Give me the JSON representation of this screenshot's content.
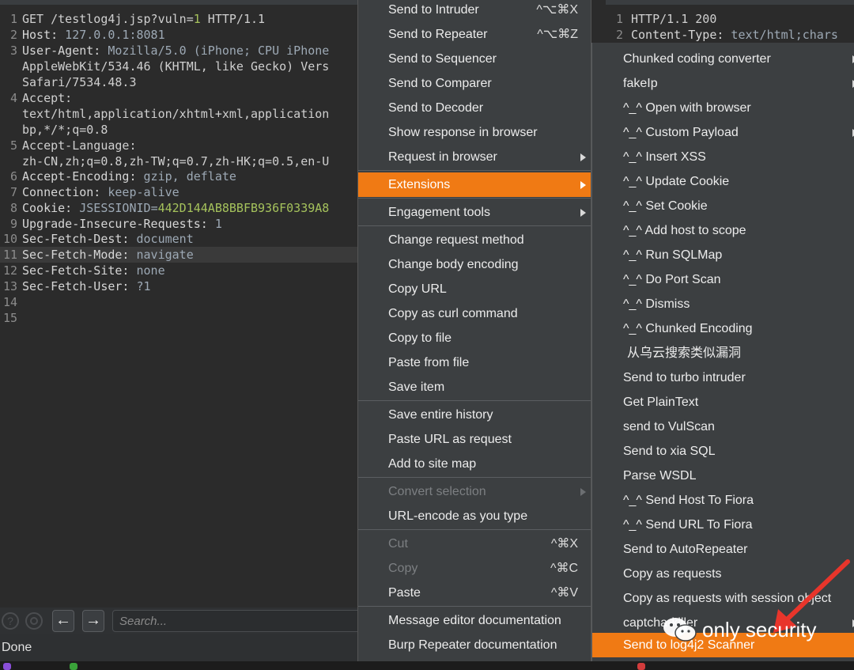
{
  "request": {
    "line_numbers": [
      "1",
      "2",
      "3",
      "4",
      "5",
      "6",
      "7",
      "8",
      "9",
      "10",
      "11",
      "12",
      "13",
      "14",
      "15"
    ],
    "lines": {
      "l1a": "GET /testlog4j.jsp?vuln=",
      "l1b": "1",
      "l1c": " HTTP/1.1",
      "l2k": "Host:",
      "l2v": " 127.0.0.1:8081",
      "l3k": "User-Agent:",
      "l3v": " Mozilla/5.0 (iPhone; CPU iPhone",
      "l3w": "AppleWebKit/534.46 (KHTML, like Gecko) Vers",
      "l3x": "Safari/7534.48.3",
      "l4k": "Accept:",
      "l4v": "text/html,application/xhtml+xml,application",
      "l4w": "bp,*/*;q=0.8",
      "l5k": "Accept-Language:",
      "l5v": "zh-CN,zh;q=0.8,zh-TW;q=0.7,zh-HK;q=0.5,en-U",
      "l6k": "Accept-Encoding:",
      "l6v": " gzip, deflate",
      "l7k": "Connection:",
      "l7v": " keep-alive",
      "l8k": "Cookie:",
      "l8v": " JSESSIONID",
      "l8e": "=",
      "l8g": "442D144AB8BBFB936F0339A8",
      "l9k": "Upgrade-Insecure-Requests:",
      "l9v": " 1",
      "l10k": "Sec-Fetch-Dest:",
      "l10v": " document",
      "l11k": "Sec-Fetch-Mode:",
      "l11v": " navigate",
      "l12k": "Sec-Fetch-Site:",
      "l12v": " none",
      "l13k": "Sec-Fetch-User:",
      "l13v": " ?1"
    }
  },
  "response": {
    "line_numbers": [
      "1",
      "2"
    ],
    "l1": "HTTP/1.1 200",
    "l2k": "Content-Type:",
    "l2v": " text/html;chars"
  },
  "toolbar": {
    "help_icon": "?",
    "back_icon": "←",
    "forward_icon": "→",
    "search_placeholder": "Search..."
  },
  "status": "Done",
  "context_menu": {
    "items": [
      {
        "label": "Send to Intruder",
        "shortcut": "^⌥⌘X"
      },
      {
        "label": "Send to Repeater",
        "shortcut": "^⌥⌘Z"
      },
      {
        "label": "Send to Sequencer"
      },
      {
        "label": "Send to Comparer"
      },
      {
        "label": "Send to Decoder"
      },
      {
        "label": "Show response in browser"
      },
      {
        "label": "Request in browser"
      },
      {
        "label": "Extensions"
      },
      {
        "label": "Engagement tools"
      },
      {
        "label": "Change request method"
      },
      {
        "label": "Change body encoding"
      },
      {
        "label": "Copy URL"
      },
      {
        "label": "Copy as curl command"
      },
      {
        "label": "Copy to file"
      },
      {
        "label": "Paste from file"
      },
      {
        "label": "Save item"
      },
      {
        "label": "Save entire history"
      },
      {
        "label": "Paste URL as request"
      },
      {
        "label": "Add to site map"
      },
      {
        "label": "Convert selection"
      },
      {
        "label": "URL-encode as you type"
      },
      {
        "label": "Cut",
        "shortcut": "^⌘X"
      },
      {
        "label": "Copy",
        "shortcut": "^⌘C"
      },
      {
        "label": "Paste",
        "shortcut": "^⌘V"
      },
      {
        "label": "Message editor documentation"
      },
      {
        "label": "Burp Repeater documentation"
      }
    ]
  },
  "extensions_menu": {
    "items": [
      "Chunked coding converter",
      "fakeIp",
      "^_^ Open with browser",
      "^_^ Custom Payload",
      "^_^ Insert XSS",
      "^_^ Update Cookie",
      "^_^ Set Cookie",
      "^_^ Add host to scope",
      "^_^ Run SQLMap",
      "^_^ Do Port Scan",
      "^_^ Dismiss",
      "^_^ Chunked Encoding",
      "从乌云搜索类似漏洞",
      "Send to turbo intruder",
      "Get PlainText",
      "send to VulScan",
      "Send to xia SQL",
      "Parse WSDL",
      "^_^ Send Host To Fiora",
      "^_^ Send URL To Fiora",
      "Send to AutoRepeater",
      "Copy as requests",
      "Copy as requests with session object",
      "captcha-killer",
      "Send to log4j2 Scanner"
    ]
  },
  "watermark": {
    "text": "only security",
    "icon": "wechat-icon"
  },
  "colors": {
    "accent": "#f07a14",
    "background": "#2b2b2b",
    "menu_bg": "#3c3f41"
  }
}
